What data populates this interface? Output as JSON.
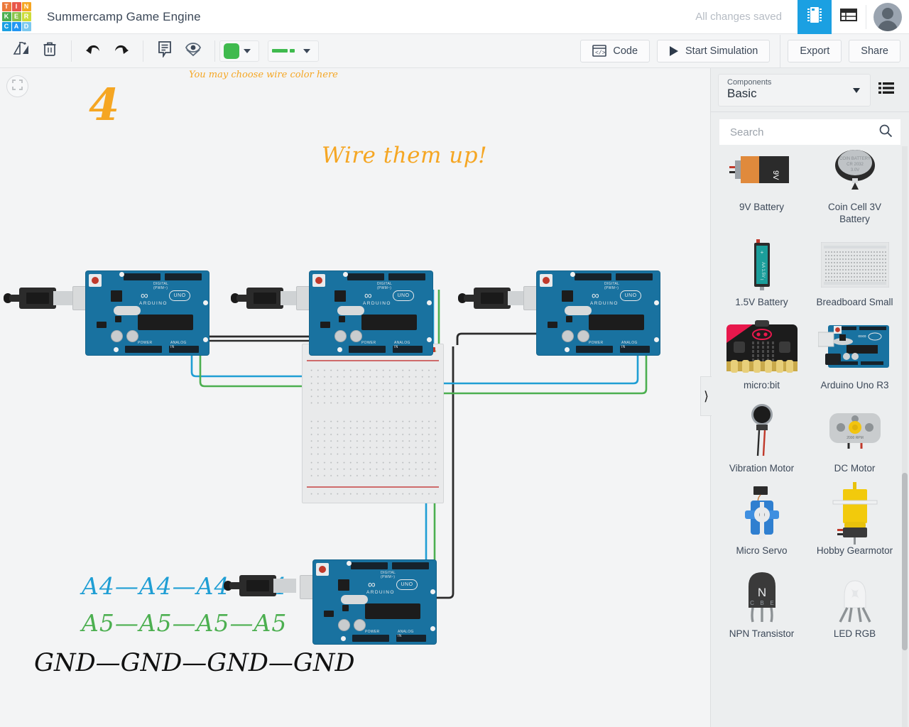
{
  "header": {
    "logo_rows": [
      [
        {
          "ch": "T",
          "color": "#ec7a3c"
        },
        {
          "ch": "I",
          "color": "#e8564b"
        },
        {
          "ch": "N",
          "color": "#f5a623"
        }
      ],
      [
        {
          "ch": "K",
          "color": "#4caf50"
        },
        {
          "ch": "E",
          "color": "#8bc34a"
        },
        {
          "ch": "R",
          "color": "#cddc39"
        }
      ],
      [
        {
          "ch": "C",
          "color": "#1ba0e2"
        },
        {
          "ch": "A",
          "color": "#2196f3"
        },
        {
          "ch": "D",
          "color": "#7cc8ee"
        }
      ]
    ],
    "title": "Summercamp Game Engine",
    "save_status": "All changes saved",
    "circuit_view_icon": "chip-icon",
    "list_view_icon": "list-view-icon",
    "avatar_icon": "user-avatar"
  },
  "toolbar": {
    "rotate_icon": "rotate-icon",
    "delete_icon": "trash-icon",
    "undo_icon": "undo-icon",
    "redo_icon": "redo-icon",
    "notes_icon": "annotation-icon",
    "visibility_icon": "eye-icon",
    "wire_color_swatch": "#3fba4e",
    "wire_color_caret": "chevron-down-icon",
    "wire_style_caret": "chevron-down-icon",
    "code_label": "Code",
    "code_icon": "code-window-icon",
    "simulate_label": "Start Simulation",
    "simulate_icon": "play-icon",
    "export_label": "Export",
    "share_label": "Share"
  },
  "canvas": {
    "fit_icon": "fit-to-screen-icon",
    "annotations": {
      "step_number": "4",
      "wire_color_hint": "You may choose wire color here",
      "wire_them_up": "Wire them up!",
      "pin_a4": "A4—A4—A4—A4",
      "pin_a5": "A5—A5—A5—A5",
      "pin_gnd": "GND—GND—GND—GND"
    },
    "colors": {
      "annotation_orange": "#f5a623",
      "a4_blue": "#1f9ed4",
      "a5_green": "#4caf50",
      "gnd_black": "#111111"
    },
    "boards": [
      {
        "name": "Arduino Uno R3",
        "silk_brand": "ARDUINO",
        "silk_model": "UNO",
        "silk_digital": "DIGITAL (PWM~)",
        "silk_power": "POWER",
        "silk_analog": "ANALOG IN"
      },
      {
        "name": "Arduino Uno R3",
        "silk_brand": "ARDUINO",
        "silk_model": "UNO",
        "silk_digital": "DIGITAL (PWM~)",
        "silk_power": "POWER",
        "silk_analog": "ANALOG IN"
      },
      {
        "name": "Arduino Uno R3",
        "silk_brand": "ARDUINO",
        "silk_model": "UNO",
        "silk_digital": "DIGITAL (PWM~)",
        "silk_power": "POWER",
        "silk_analog": "ANALOG IN"
      },
      {
        "name": "Arduino Uno R3",
        "silk_brand": "ARDUINO",
        "silk_model": "UNO",
        "silk_digital": "DIGITAL (PWM~)",
        "silk_power": "POWER",
        "silk_analog": "ANALOG IN"
      }
    ],
    "breadboard": {
      "name": "Breadboard"
    }
  },
  "components_panel": {
    "dropdown_label": "Components",
    "dropdown_value": "Basic",
    "list_icon": "list-icon",
    "search_placeholder": "Search",
    "search_value": "",
    "search_icon": "search-icon",
    "collapse_icon": "chevron-right-icon",
    "items": [
      {
        "label": "9V Battery",
        "icon": "9v-battery-icon"
      },
      {
        "label": "Coin Cell 3V Battery",
        "icon": "coin-cell-icon"
      },
      {
        "label": "1.5V Battery",
        "icon": "aa-battery-icon"
      },
      {
        "label": "Breadboard Small",
        "icon": "breadboard-small-icon"
      },
      {
        "label": "micro:bit",
        "icon": "microbit-icon"
      },
      {
        "label": "Arduino Uno R3",
        "icon": "arduino-uno-icon"
      },
      {
        "label": "Vibration Motor",
        "icon": "vibration-motor-icon"
      },
      {
        "label": "DC Motor",
        "icon": "dc-motor-icon"
      },
      {
        "label": "Micro Servo",
        "icon": "micro-servo-icon"
      },
      {
        "label": "Hobby Gearmotor",
        "icon": "hobby-gearmotor-icon"
      },
      {
        "label": "NPN Transistor",
        "icon": "npn-transistor-icon"
      },
      {
        "label": "LED RGB",
        "icon": "led-rgb-icon"
      }
    ]
  }
}
